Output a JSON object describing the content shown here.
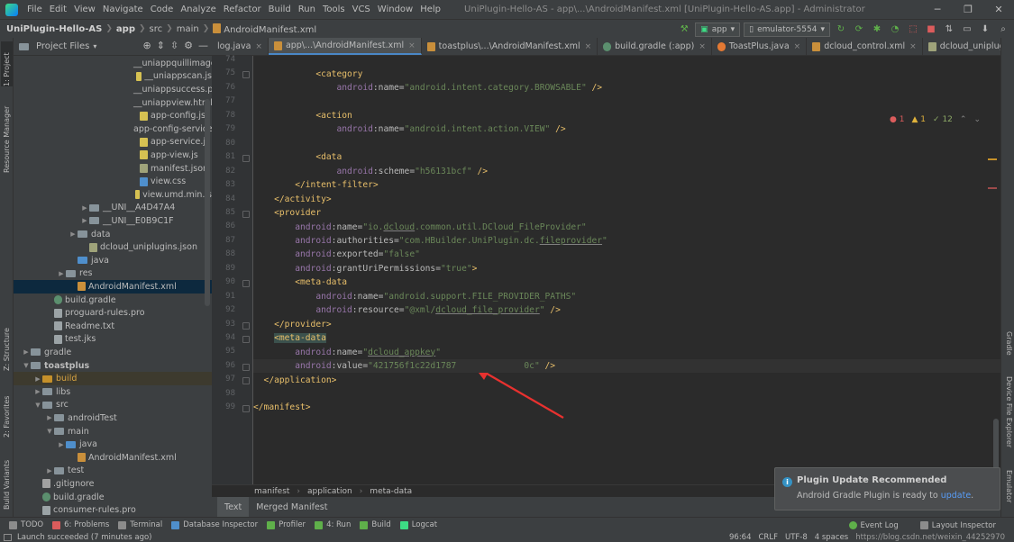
{
  "menubar": {
    "items": [
      "File",
      "Edit",
      "View",
      "Navigate",
      "Code",
      "Analyze",
      "Refactor",
      "Build",
      "Run",
      "Tools",
      "VCS",
      "Window",
      "Help"
    ],
    "window_title": "UniPlugin-Hello-AS - app\\...\\AndroidManifest.xml [UniPlugin-Hello-AS.app] - Administrator"
  },
  "navbar": {
    "project": "UniPlugin-Hello-AS",
    "crumbs": [
      "app",
      "src",
      "main"
    ],
    "file": "AndroidManifest.xml",
    "run_config": "app",
    "device": "emulator-5554"
  },
  "project_panel": {
    "title": "Project Files",
    "rows": [
      {
        "label": "__uniappquillimage",
        "icon": "js",
        "indent": 140,
        "arrow": ""
      },
      {
        "label": "__uniappscan.js",
        "icon": "js",
        "indent": 140,
        "arrow": ""
      },
      {
        "label": "__uniappsuccess.pn",
        "icon": "js",
        "indent": 140,
        "arrow": ""
      },
      {
        "label": "__uniappview.html",
        "icon": "html",
        "indent": 140,
        "arrow": ""
      },
      {
        "label": "app-config.js",
        "icon": "js",
        "indent": 140,
        "arrow": ""
      },
      {
        "label": "app-config-service.",
        "icon": "js",
        "indent": 140,
        "arrow": ""
      },
      {
        "label": "app-service.js",
        "icon": "js",
        "indent": 140,
        "arrow": ""
      },
      {
        "label": "app-view.js",
        "icon": "js",
        "indent": 140,
        "arrow": ""
      },
      {
        "label": "manifest.json",
        "icon": "json",
        "indent": 140,
        "arrow": ""
      },
      {
        "label": "view.css",
        "icon": "css",
        "indent": 140,
        "arrow": ""
      },
      {
        "label": "view.umd.min.js",
        "icon": "js",
        "indent": 140,
        "arrow": ""
      },
      {
        "label": "__UNI__A4D47A4",
        "icon": "folder",
        "indent": 84,
        "arrow": ">"
      },
      {
        "label": "__UNI__E0B9C1F",
        "icon": "folder",
        "indent": 84,
        "arrow": ">"
      },
      {
        "label": "data",
        "icon": "folder",
        "indent": 71,
        "arrow": ">"
      },
      {
        "label": "dcloud_uniplugins.json",
        "icon": "json",
        "indent": 84,
        "arrow": ""
      },
      {
        "label": "java",
        "icon": "folder-blue",
        "indent": 71,
        "arrow": ""
      },
      {
        "label": "res",
        "icon": "folder",
        "indent": 58,
        "arrow": ">"
      },
      {
        "label": "AndroidManifest.xml",
        "icon": "xml",
        "indent": 71,
        "arrow": "",
        "selected": true
      },
      {
        "label": "build.gradle",
        "icon": "gradle",
        "indent": 45,
        "arrow": ""
      },
      {
        "label": "proguard-rules.pro",
        "icon": "txt",
        "indent": 45,
        "arrow": ""
      },
      {
        "label": "Readme.txt",
        "icon": "txt",
        "indent": 45,
        "arrow": ""
      },
      {
        "label": "test.jks",
        "icon": "txt",
        "indent": 45,
        "arrow": ""
      },
      {
        "label": "gradle",
        "icon": "folder",
        "indent": 19,
        "arrow": ">"
      },
      {
        "label": "toastplus",
        "icon": "folder",
        "indent": 19,
        "arrow": "v",
        "bold": true
      },
      {
        "label": "build",
        "icon": "folder-orange",
        "indent": 32,
        "arrow": ">",
        "build": true
      },
      {
        "label": "libs",
        "icon": "folder",
        "indent": 32,
        "arrow": ">"
      },
      {
        "label": "src",
        "icon": "folder",
        "indent": 32,
        "arrow": "v"
      },
      {
        "label": "androidTest",
        "icon": "folder",
        "indent": 45,
        "arrow": ">"
      },
      {
        "label": "main",
        "icon": "folder",
        "indent": 45,
        "arrow": "v"
      },
      {
        "label": "java",
        "icon": "folder-blue",
        "indent": 58,
        "arrow": ">"
      },
      {
        "label": "AndroidManifest.xml",
        "icon": "xml",
        "indent": 71,
        "arrow": ""
      },
      {
        "label": "test",
        "icon": "folder",
        "indent": 45,
        "arrow": ">"
      },
      {
        "label": ".gitignore",
        "icon": "git",
        "indent": 32,
        "arrow": ""
      },
      {
        "label": "build.gradle",
        "icon": "gradle",
        "indent": 32,
        "arrow": ""
      },
      {
        "label": "consumer-rules.pro",
        "icon": "txt",
        "indent": 32,
        "arrow": ""
      }
    ]
  },
  "editor_tabs": [
    {
      "label": "log.java",
      "icon": "java",
      "active": false
    },
    {
      "label": "app\\...\\AndroidManifest.xml",
      "icon": "xml",
      "active": true
    },
    {
      "label": "toastplus\\...\\AndroidManifest.xml",
      "icon": "xml",
      "active": false
    },
    {
      "label": "build.gradle (:app)",
      "icon": "gradle",
      "active": false
    },
    {
      "label": "ToastPlus.java",
      "icon": "java",
      "active": false
    },
    {
      "label": "dcloud_control.xml",
      "icon": "xml",
      "active": false
    },
    {
      "label": "dcloud_uniplugins.json",
      "icon": "json",
      "active": false
    }
  ],
  "inspection": {
    "errors": "1",
    "warnings": "1",
    "weak": "12"
  },
  "code": [
    {
      "n": "74",
      "indent": 0,
      "parts": []
    },
    {
      "n": "75",
      "indent": 12,
      "parts": [
        [
          "tag",
          "<category"
        ]
      ]
    },
    {
      "n": "76",
      "indent": 16,
      "parts": [
        [
          "attr-ns",
          "android"
        ],
        [
          "attr",
          ":name="
        ],
        [
          "val",
          "\"android.intent.category.BROWSABLE\""
        ],
        [
          "punc",
          " />"
        ]
      ]
    },
    {
      "n": "77",
      "indent": 0,
      "parts": []
    },
    {
      "n": "78",
      "indent": 12,
      "parts": [
        [
          "tag",
          "<action"
        ]
      ]
    },
    {
      "n": "79",
      "indent": 16,
      "parts": [
        [
          "attr-ns",
          "android"
        ],
        [
          "attr",
          ":name="
        ],
        [
          "val",
          "\"android.intent.action.VIEW\""
        ],
        [
          "punc",
          " />"
        ]
      ]
    },
    {
      "n": "80",
      "indent": 0,
      "parts": []
    },
    {
      "n": "81",
      "indent": 12,
      "parts": [
        [
          "tag",
          "<data"
        ]
      ]
    },
    {
      "n": "82",
      "indent": 16,
      "parts": [
        [
          "attr-ns",
          "android"
        ],
        [
          "attr",
          ":scheme="
        ],
        [
          "val",
          "\"h56131bcf\""
        ],
        [
          "punc",
          " />"
        ]
      ]
    },
    {
      "n": "83",
      "indent": 8,
      "parts": [
        [
          "tag",
          "</intent-filter>"
        ]
      ]
    },
    {
      "n": "84",
      "indent": 4,
      "parts": [
        [
          "tag",
          "</activity>"
        ]
      ]
    },
    {
      "n": "85",
      "indent": 4,
      "parts": [
        [
          "tag",
          "<provider"
        ]
      ]
    },
    {
      "n": "86",
      "indent": 8,
      "parts": [
        [
          "attr-ns",
          "android"
        ],
        [
          "attr",
          ":name="
        ],
        [
          "val",
          "\"io."
        ],
        [
          "val ul",
          "dcloud"
        ],
        [
          "val",
          ".common.util.DCloud_FileProvider\""
        ]
      ]
    },
    {
      "n": "87",
      "indent": 8,
      "parts": [
        [
          "attr-ns",
          "android"
        ],
        [
          "attr",
          ":authorities="
        ],
        [
          "val",
          "\"com.HBuilder.UniPlugin.dc."
        ],
        [
          "val ul",
          "fileprovider"
        ],
        [
          "val",
          "\""
        ]
      ]
    },
    {
      "n": "88",
      "indent": 8,
      "parts": [
        [
          "attr-ns",
          "android"
        ],
        [
          "attr",
          ":exported="
        ],
        [
          "val",
          "\"false\""
        ]
      ]
    },
    {
      "n": "89",
      "indent": 8,
      "parts": [
        [
          "attr-ns",
          "android"
        ],
        [
          "attr",
          ":grantUriPermissions="
        ],
        [
          "val",
          "\"true\""
        ],
        [
          "punc",
          ">"
        ]
      ]
    },
    {
      "n": "90",
      "indent": 8,
      "parts": [
        [
          "tag",
          "<meta-data"
        ]
      ]
    },
    {
      "n": "91",
      "indent": 12,
      "parts": [
        [
          "attr-ns",
          "android"
        ],
        [
          "attr",
          ":name="
        ],
        [
          "val",
          "\"android.support.FILE_PROVIDER_PATHS\""
        ]
      ]
    },
    {
      "n": "92",
      "indent": 12,
      "parts": [
        [
          "attr-ns",
          "android"
        ],
        [
          "attr",
          ":resource="
        ],
        [
          "val",
          "\"@xml/"
        ],
        [
          "val ul",
          "dcloud_file_provider"
        ],
        [
          "val",
          "\""
        ],
        [
          "punc",
          " />"
        ]
      ]
    },
    {
      "n": "93",
      "indent": 4,
      "parts": [
        [
          "tag",
          "</provider>"
        ]
      ]
    },
    {
      "n": "94",
      "indent": 4,
      "parts": [
        [
          "tag hl-tag",
          "<meta-data"
        ]
      ]
    },
    {
      "n": "95",
      "indent": 8,
      "parts": [
        [
          "attr-ns",
          "android"
        ],
        [
          "attr",
          ":name="
        ],
        [
          "val",
          "\""
        ],
        [
          "val ul",
          "dcloud_appkey"
        ],
        [
          "val",
          "\""
        ]
      ]
    },
    {
      "n": "96",
      "indent": 8,
      "current": true,
      "parts": [
        [
          "attr-ns",
          "android"
        ],
        [
          "attr",
          ":value="
        ],
        [
          "val",
          "\"421756f1c22d1787             0c\""
        ],
        [
          "punc",
          " />"
        ]
      ]
    },
    {
      "n": "97",
      "indent": 2,
      "parts": [
        [
          "tag",
          "</application>"
        ]
      ]
    },
    {
      "n": "98",
      "indent": 0,
      "parts": []
    },
    {
      "n": "99",
      "indent": 0,
      "parts": [
        [
          "tag",
          "</manifest>"
        ]
      ]
    }
  ],
  "breadcrumb": [
    "manifest",
    "application",
    "meta-data"
  ],
  "bottom_tabs": [
    "Text",
    "Merged Manifest"
  ],
  "notification": {
    "title": "Plugin Update Recommended",
    "body": "Android Gradle Plugin is ready to ",
    "link": "update",
    "body_end": "."
  },
  "left_tabs": [
    "1: Project",
    "Resource Manager",
    "Z: Structure",
    "2: Favorites",
    "Build Variants"
  ],
  "right_tabs": [
    "Gradle",
    "Device File Explorer",
    "Emulator"
  ],
  "toolwindows": [
    "TODO",
    "6: Problems",
    "Terminal",
    "Database Inspector",
    "Profiler",
    "4: Run",
    "Build",
    "Logcat"
  ],
  "toolwindows_right": [
    "Event Log",
    "Layout Inspector"
  ],
  "status": {
    "message": "Launch succeeded (7 minutes ago)",
    "right": [
      "96:64",
      "CRLF",
      "UTF-8",
      "4 spaces"
    ],
    "watermark": "https://blog.csdn.net/weixin_44252970"
  },
  "colors": {
    "accent": "#4a88c7",
    "tag": "#e8bf6a",
    "value": "#6a8759",
    "arrow": "#e8312f"
  }
}
